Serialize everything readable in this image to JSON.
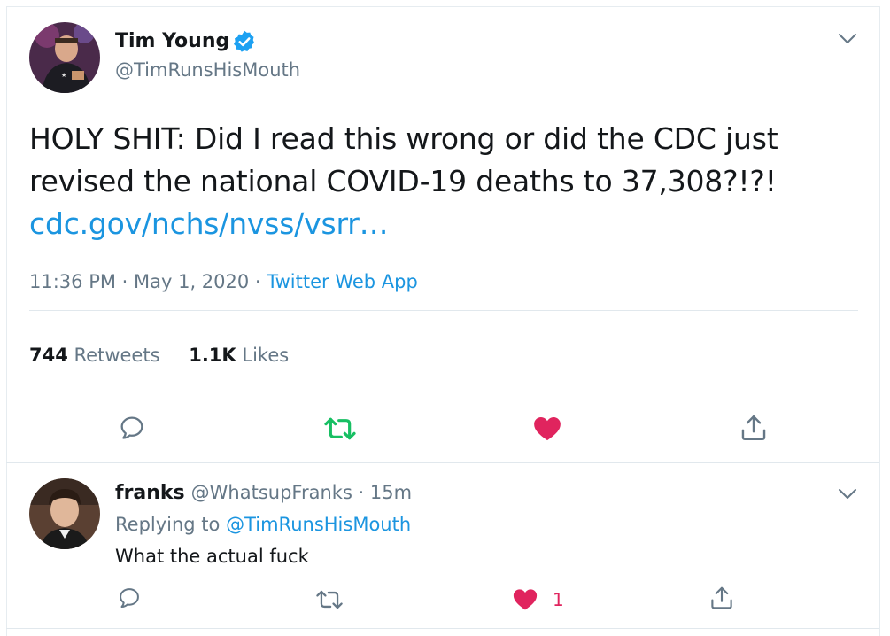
{
  "main_tweet": {
    "author_name": "Tim Young",
    "author_handle": "@TimRunsHisMouth",
    "text_line1": "HOLY SHIT:  Did I read this wrong or did the CDC just",
    "text_line2": "revised the national COVID-19 deaths to 37,308?!?!",
    "link": "cdc.gov/nchs/nvss/vsrr…",
    "time": "11:36 PM · May 1, 2020 · ",
    "source": "Twitter Web App",
    "retweets_count": "744",
    "retweets_label": "Retweets",
    "likes_count": "1.1K",
    "likes_label": "Likes"
  },
  "reply": {
    "author_name": "franks",
    "author_handle": "@WhatsupFranks · 15m",
    "replying_label": "Replying to ",
    "replying_to": "@TimRunsHisMouth",
    "text": "What the actual fuck",
    "like_count": "1"
  },
  "colors": {
    "link": "#1b95e0",
    "retweeted": "#17bf63",
    "liked": "#e0245e",
    "verified": "#1da1f2",
    "muted": "#657786"
  },
  "icons": [
    "verified-badge-icon",
    "chevron-down-icon",
    "reply-icon",
    "retweet-icon",
    "like-icon",
    "share-icon"
  ]
}
